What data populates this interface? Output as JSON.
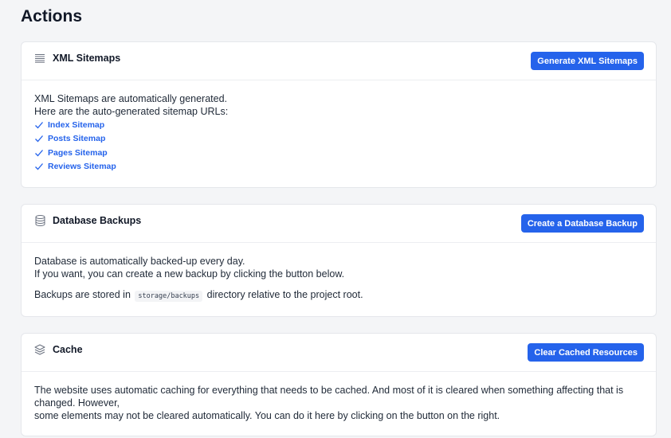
{
  "page": {
    "title": "Actions"
  },
  "sitemaps": {
    "title": "XML Sitemaps",
    "icon": "list-lines-icon",
    "button_label": "Generate XML Sitemaps",
    "line1": "XML Sitemaps are automatically generated.",
    "line2": "Here are the auto-generated sitemap URLs:",
    "links": [
      {
        "label": "Index Sitemap"
      },
      {
        "label": "Posts Sitemap"
      },
      {
        "label": "Pages Sitemap"
      },
      {
        "label": "Reviews Sitemap"
      }
    ]
  },
  "backups": {
    "title": "Database Backups",
    "icon": "database-icon",
    "button_label": "Create a Database Backup",
    "line1": "Database is automatically backed-up every day.",
    "line2": "If you want, you can create a new backup by clicking the button below.",
    "stored_prefix": "Backups are stored in",
    "stored_path": "storage/backups",
    "stored_suffix": "directory relative to the project root."
  },
  "cache": {
    "title": "Cache",
    "icon": "layers-icon",
    "button_label": "Clear Cached Resources",
    "line1": "The website uses automatic caching for everything that needs to be cached. And most of it is cleared when something affecting that is changed. However,",
    "line2": "some elements may not be cleared automatically. You can do it here by clicking on the button on the right."
  },
  "colors": {
    "accent": "#2563eb",
    "background": "#f4f5f7",
    "card": "#ffffff"
  }
}
